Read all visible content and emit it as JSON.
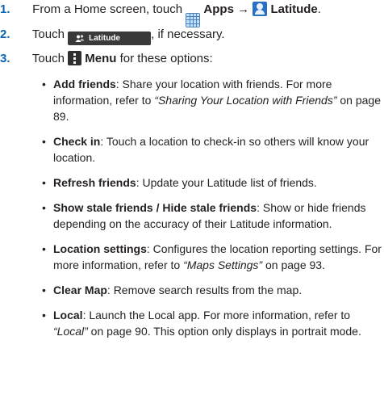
{
  "steps": [
    {
      "num": "1.",
      "pre": "From a Home screen, touch",
      "apps_label": "Apps",
      "arrow": "→",
      "latitude_label": "Latitude",
      "post": "."
    },
    {
      "num": "2.",
      "pre": "Touch",
      "button_label": "Latitude",
      "post": ", if necessary."
    },
    {
      "num": "3.",
      "pre": "Touch",
      "menu_label": "Menu",
      "post": "for these options:"
    }
  ],
  "bullets": [
    {
      "title": "Add friends",
      "text": ": Share your location with friends. For more information, refer to ",
      "ref": "“Sharing Your Location with Friends”",
      "page": " on page 89."
    },
    {
      "title": "Check in",
      "text": ": Touch a location to check-in so others will know your location."
    },
    {
      "title": "Refresh friends",
      "text": ": Update your Latitude list of friends."
    },
    {
      "title": "Show stale friends / Hide stale friends",
      "text": ": Show or hide friends depending on the accuracy of their Latitude information."
    },
    {
      "title": "Location settings",
      "text": ": Configures the location reporting settings. For more information, refer to ",
      "ref": "“Maps Settings”",
      "page": " on page 93."
    },
    {
      "title": "Clear Map",
      "text": ": Remove search results from the map."
    },
    {
      "title": "Local",
      "text": ": Launch the Local app. For more information, refer to ",
      "ref": "“Local”",
      "page": " on page 90. This option only displays in portrait mode."
    }
  ],
  "icons": {
    "apps": "apps-grid-icon",
    "latitude": "latitude-person-icon",
    "button_people": "friends-icon",
    "menu": "menu-dots-icon"
  },
  "colors": {
    "accent": "#0a66b3",
    "text": "#231f20"
  }
}
